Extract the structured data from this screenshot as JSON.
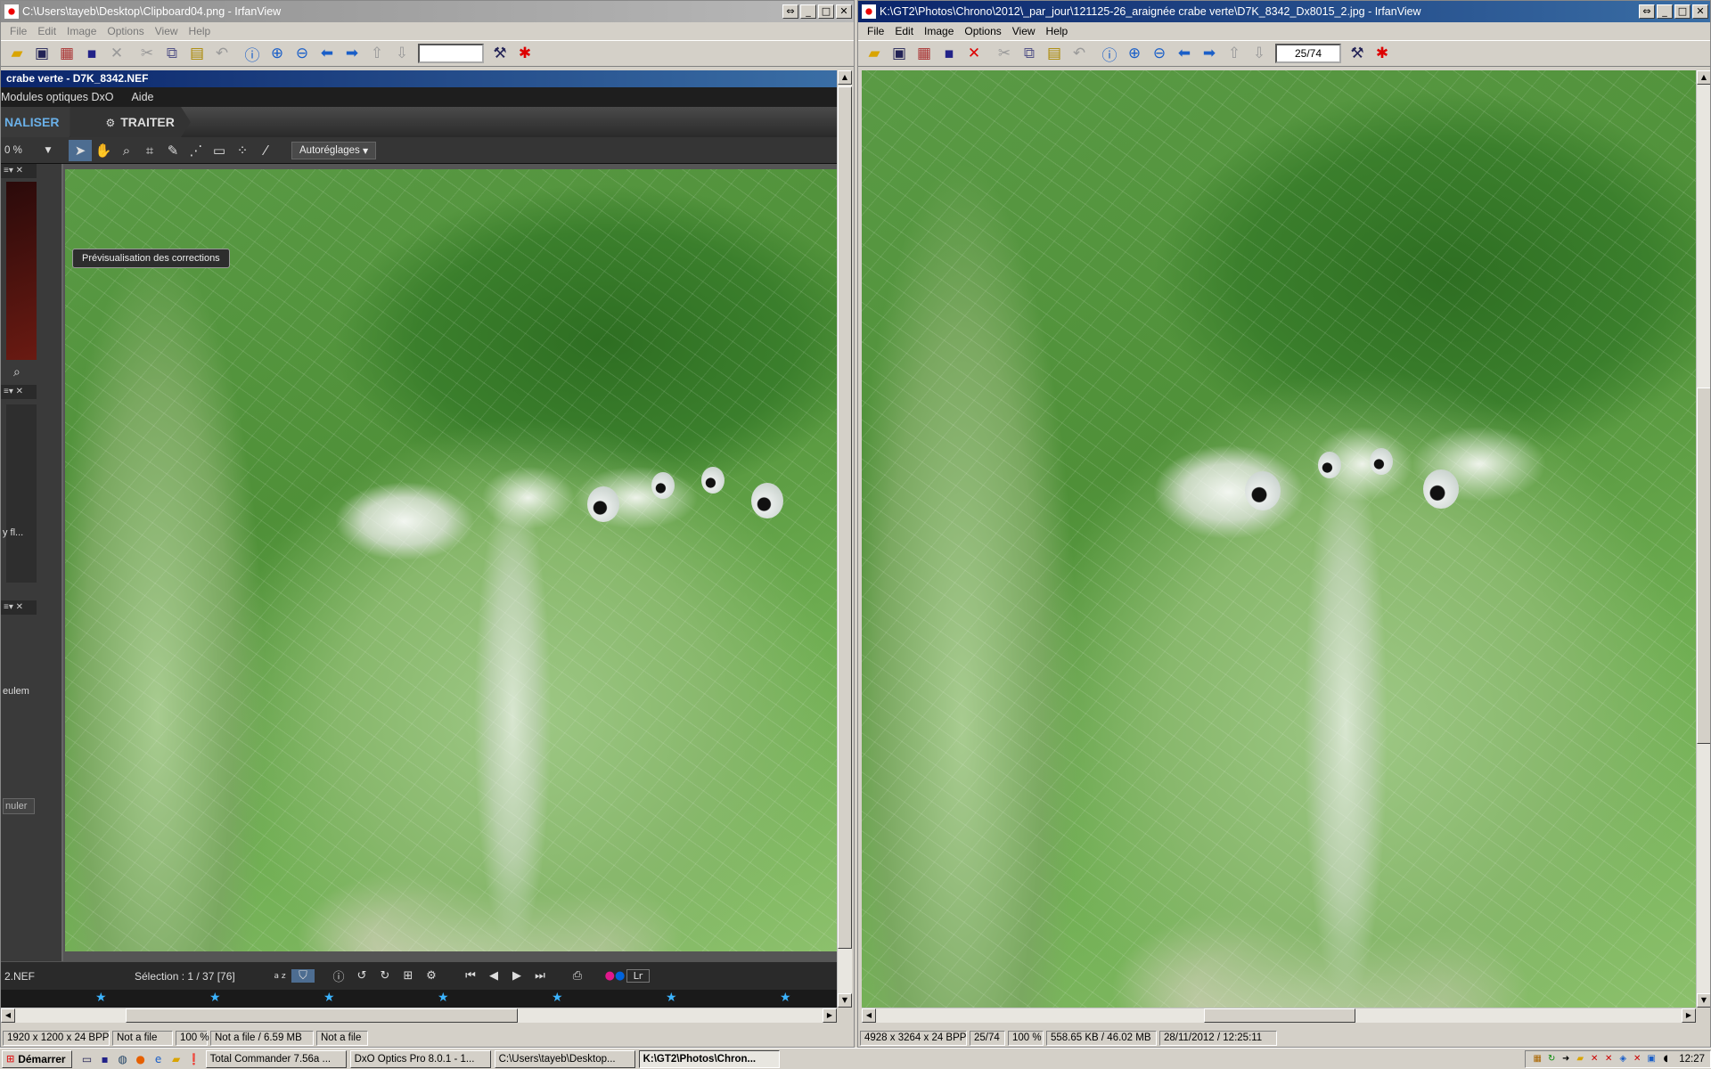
{
  "left_window": {
    "title": "C:\\Users\\tayeb\\Desktop\\Clipboard04.png - IrfanView",
    "menu": [
      "File",
      "Edit",
      "Image",
      "Options",
      "View",
      "Help"
    ],
    "page_field": "",
    "status": [
      "1920 x 1200 x 24 BPP",
      "Not a file",
      "100 %",
      "Not a file / 6.59 MB",
      "Not a file"
    ]
  },
  "dxo": {
    "title": "crabe verte - D7K_8342.NEF",
    "menu": [
      "Modules optiques DxO",
      "Aide"
    ],
    "tab_customize": "NALISER",
    "tab_process": "TRAITER",
    "zoom": "0 %",
    "autoreglages": "Autoréglages",
    "tooltip": "Prévisualisation des corrections",
    "side_text_1": "y fl...",
    "side_text_2": "eulem",
    "side_text_3": "nuler",
    "file_label": "2.NEF",
    "selection": "Sélection : 1 / 37 [76]",
    "sort_label": "a z",
    "lr_label": "Lr"
  },
  "right_window": {
    "title": "K:\\GT2\\Photos\\Chrono\\2012\\_par_jour\\121125-26_araignée crabe verte\\D7K_8342_Dx8015_2.jpg - IrfanView",
    "menu": [
      "File",
      "Edit",
      "Image",
      "Options",
      "View",
      "Help"
    ],
    "page_field": "25/74",
    "status": [
      "4928 x 3264 x 24 BPP",
      "25/74",
      "100 %",
      "558.65 KB / 46.02 MB",
      "28/11/2012 / 12:25:11"
    ]
  },
  "icons": {
    "open": "📂",
    "info": "ⓘ",
    "zoom_in": "⊕",
    "zoom_out": "⊖",
    "prev": "⬅",
    "next": "➡"
  },
  "taskbar": {
    "start": "Démarrer",
    "tasks": [
      "Total Commander 7.56a ...",
      "DxO Optics Pro 8.0.1 - 1...",
      "C:\\Users\\tayeb\\Desktop...",
      "K:\\GT2\\Photos\\Chron..."
    ],
    "clock": "12:27"
  },
  "colors": {
    "active_title": "#0a246a",
    "dxo_accent": "#6ab0e8",
    "filmstrip_star": "#3cb4ff"
  }
}
